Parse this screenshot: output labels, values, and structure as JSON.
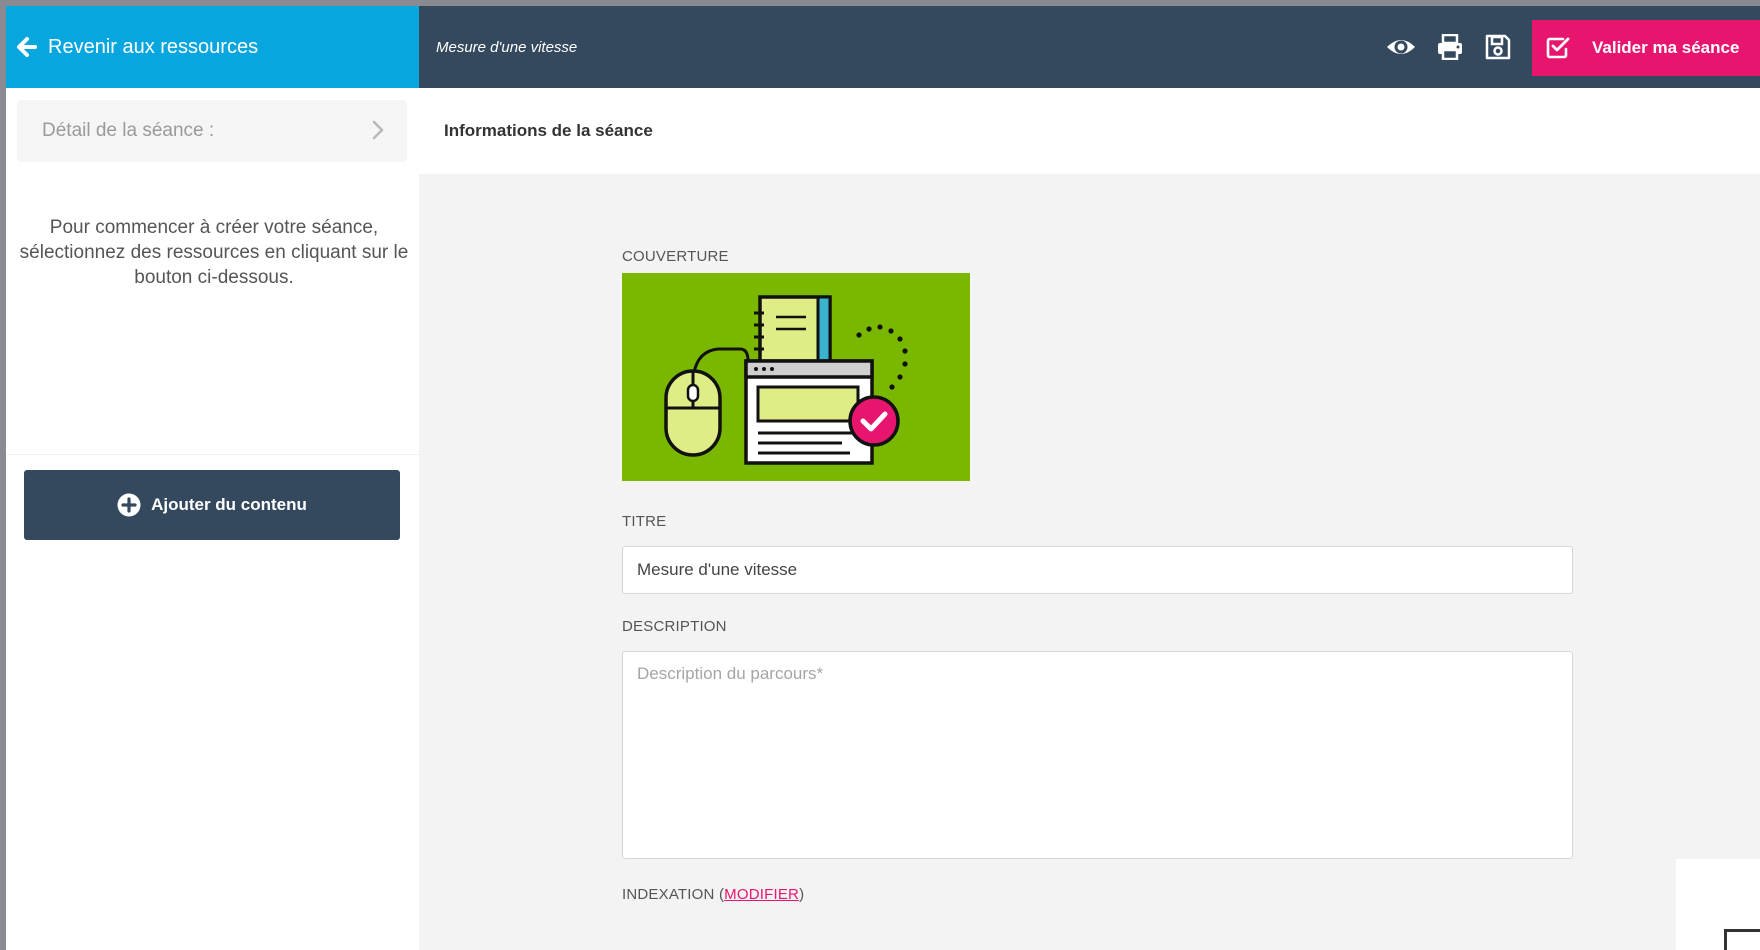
{
  "topbar": {
    "back_label": "Revenir aux ressources",
    "session_title": "Mesure d'une vitesse",
    "validate_label": "Valider ma séance",
    "icons": [
      "eye-icon",
      "print-icon",
      "save-icon",
      "check-square-icon"
    ]
  },
  "sidebar": {
    "detail_label": "Détail de la séance :",
    "help_text": "Pour commencer à créer votre séance, sélectionnez des ressources en cliquant sur le bouton ci-dessous.",
    "add_button_label": "Ajouter du contenu"
  },
  "main": {
    "header_title": "Informations de la séance",
    "cover_label": "COUVERTURE",
    "title_label": "TITRE",
    "title_value": "Mesure d'une vitesse",
    "description_label": "DESCRIPTION",
    "description_placeholder": "Description du parcours*",
    "indexation_label": "INDEXATION",
    "indexation_open": "(",
    "indexation_link": "MODIFIER",
    "indexation_close": ")"
  },
  "colors": {
    "accent_blue": "#08a6de",
    "navy": "#34495e",
    "pink": "#e8156e",
    "cover_green": "#7ab800"
  }
}
